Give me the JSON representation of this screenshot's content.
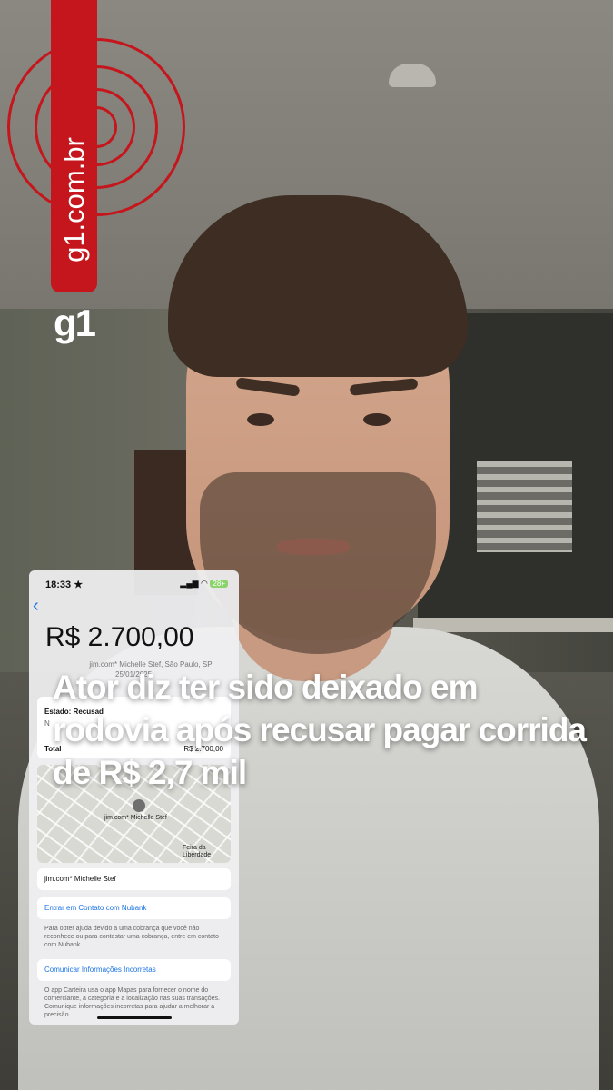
{
  "brand": {
    "site": "g1.com.br",
    "logo": "g1",
    "color": "#c4161c"
  },
  "headline": "Ator diz ter sido deixado em rodovia após recusar pagar corrida de R$ 2,7 mil",
  "phone_screenshot": {
    "time": "18:33 ★",
    "battery": "28+",
    "amount": "R$ 2.700,00",
    "merchant": "jim.com* Michelle Stef, São Paulo, SP",
    "date": "25/01/2025",
    "status": "Estado: Recusad",
    "status_line2": "N",
    "total_label": "Total",
    "total_value": "R$ 2.700,00",
    "map_label": "jim.com* Michelle Stef",
    "map_place": "Feira da Liberdade",
    "merchant_row": "jim.com* Michelle Stef",
    "contact_link": "Entrar em Contato com Nubank",
    "contact_note": "Para obter ajuda devido a uma cobrança que você não reconhece ou para contestar uma cobrança, entre em contato com Nubank.",
    "report_link": "Comunicar Informações Incorretas",
    "report_note": "O app Carteira usa o app Mapas para fornecer o nome do comerciante, a categoria e a localização nas suas transações. Comunique informações incorretas para ajudar a melhorar a precisão."
  }
}
